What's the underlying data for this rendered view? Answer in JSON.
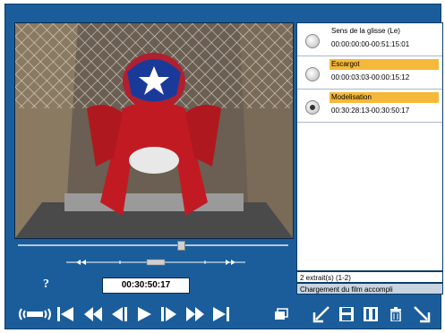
{
  "player": {
    "help_label": "?",
    "timecode": "00:30:50:17"
  },
  "clips": [
    {
      "title": "Sens de la glisse (Le)",
      "time": "00:00:00:00-00:51:15:01",
      "highlight": false,
      "selected": false
    },
    {
      "title": "Escargot",
      "time": "00:00:03:03-00:00:15:12",
      "highlight": true,
      "selected": false
    },
    {
      "title": "Modelisation",
      "time": "00:30:28:13-00:30:50:17",
      "highlight": true,
      "selected": true
    }
  ],
  "footer": {
    "count": "2 extrait(s) (1-2)",
    "status": "Chargement du film accompli"
  },
  "seek_position": 0.58,
  "colors": {
    "background": "#1a5d9a",
    "highlight": "#f5b83a"
  },
  "icons": [
    "sound-icon",
    "go-start-icon",
    "rewind-fast-icon",
    "step-back-icon",
    "play-icon",
    "step-forward-icon",
    "fast-forward-icon",
    "go-end-icon",
    "window-icon",
    "mark-in-icon",
    "save-icon",
    "film-icon",
    "trash-icon",
    "mark-out-icon"
  ]
}
